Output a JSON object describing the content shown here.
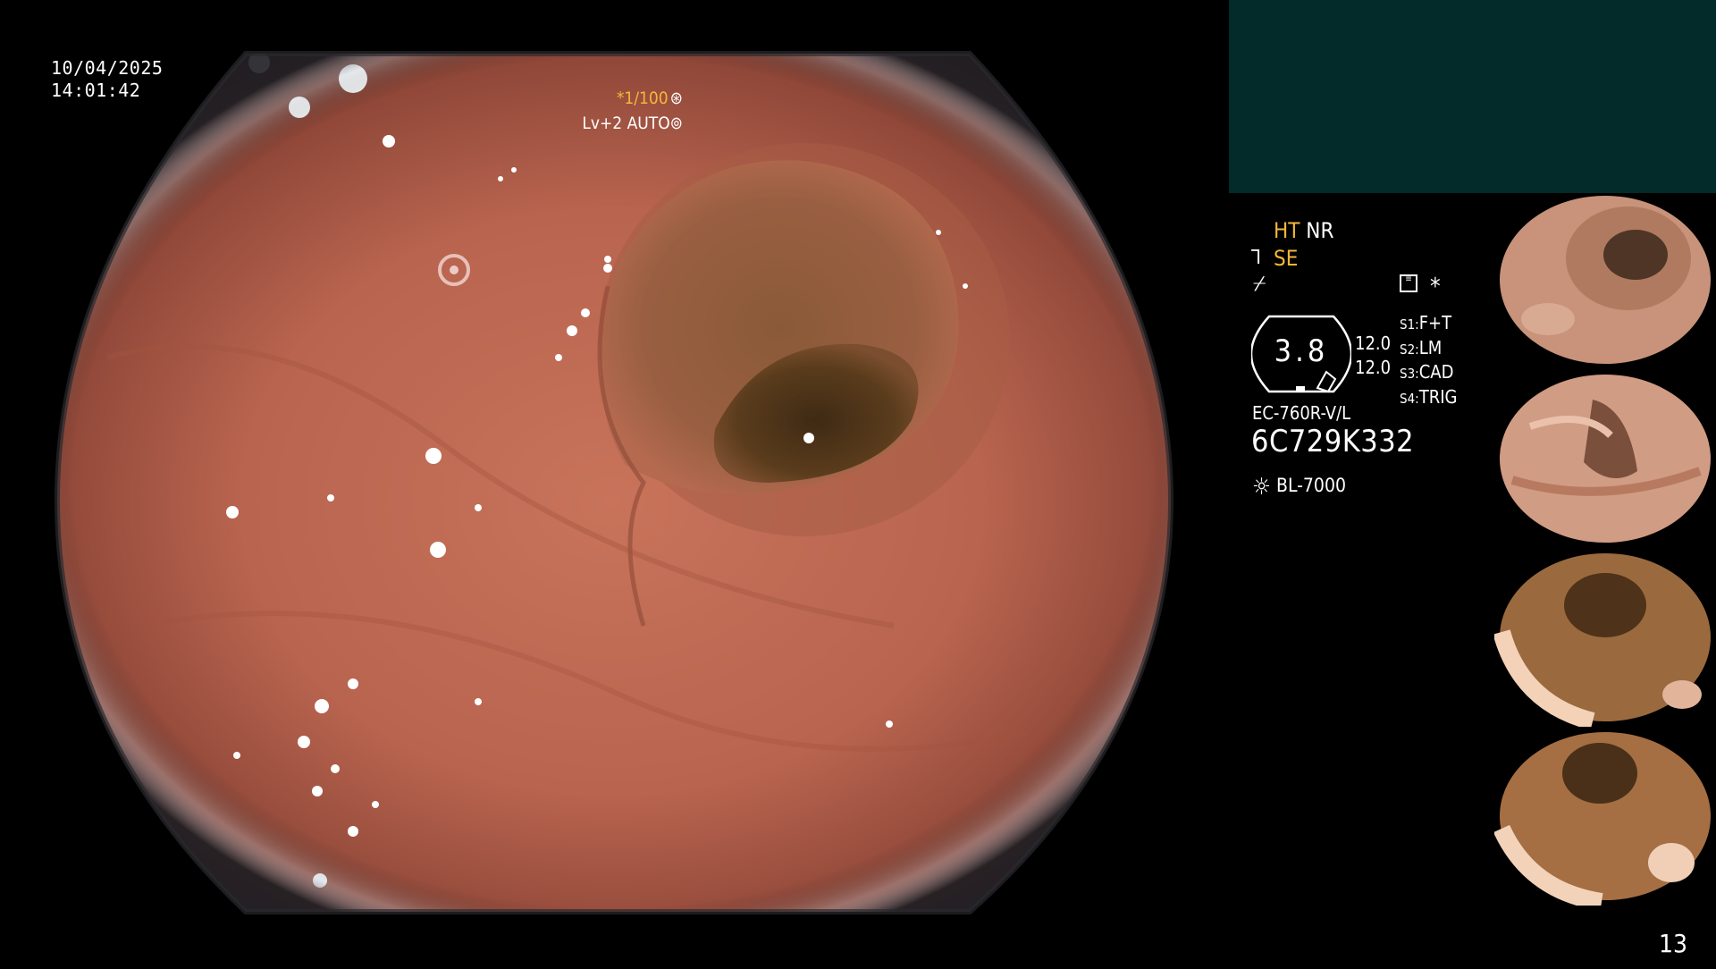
{
  "overlay": {
    "date": "10/04/2025",
    "time": "14:01:42",
    "shutter": "*1/100",
    "shutter_icon": "aperture-icon",
    "level": "Lv+2 AUTO",
    "level_icon": "target-icon"
  },
  "panel": {
    "ht": "HT",
    "nr": "NR",
    "se": "SE",
    "se_symbol": "⅂~",
    "wave_symbol": "⌿",
    "kv_icon": "keyboard-icon",
    "star": "*",
    "gauge_value": "3.8",
    "gauge_top_value": "12.0",
    "gauge_bottom_value": "12.0",
    "s_list": [
      {
        "label": "S1:",
        "value": "F+T"
      },
      {
        "label": "S2:",
        "value": "LM"
      },
      {
        "label": "S3:",
        "value": "CAD"
      },
      {
        "label": "S4:",
        "value": "TRIG"
      }
    ],
    "model": "EC-760R-V/L",
    "serial": "6C729K332",
    "light_source": "BL-7000"
  },
  "page_number": "13",
  "colors": {
    "accent_amber": "#f4b73a",
    "panel_teal": "#032b2a",
    "mucosa": "#b8644f"
  }
}
